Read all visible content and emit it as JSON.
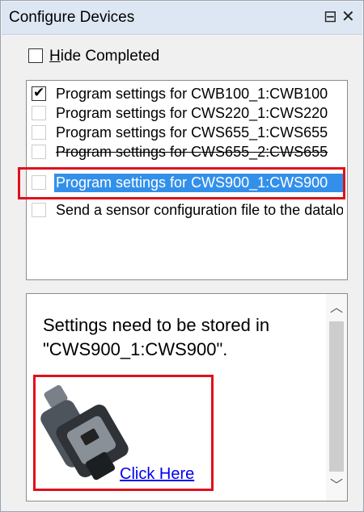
{
  "window": {
    "title": "Configure Devices",
    "float_glyph": "⊟",
    "close_glyph": "✕"
  },
  "hide_completed": {
    "label_underlined": "H",
    "label_rest": "ide Completed",
    "checked": false
  },
  "tasks": [
    {
      "text": "Program settings for CWB100_1:CWB100",
      "checked": true,
      "selected": false
    },
    {
      "text": "Program settings for CWS220_1:CWS220",
      "checked": false,
      "selected": false
    },
    {
      "text": "Program settings for CWS655_1:CWS655",
      "checked": false,
      "selected": false
    },
    {
      "text": "Program settings for CWS655_2:CWS655",
      "checked": false,
      "selected": false
    },
    {
      "text": "Program settings for CWS900_1:CWS900",
      "checked": false,
      "selected": true
    },
    {
      "text": "Send a sensor configuration file to the datalogger",
      "checked": false,
      "selected": false
    }
  ],
  "help": {
    "message_line1": "Settings need to be stored in",
    "message_line2": "\"CWS900_1:CWS900\".",
    "link_text": "Click Here",
    "highlight_color": "#e0101b",
    "selection_color": "#3390ea"
  }
}
